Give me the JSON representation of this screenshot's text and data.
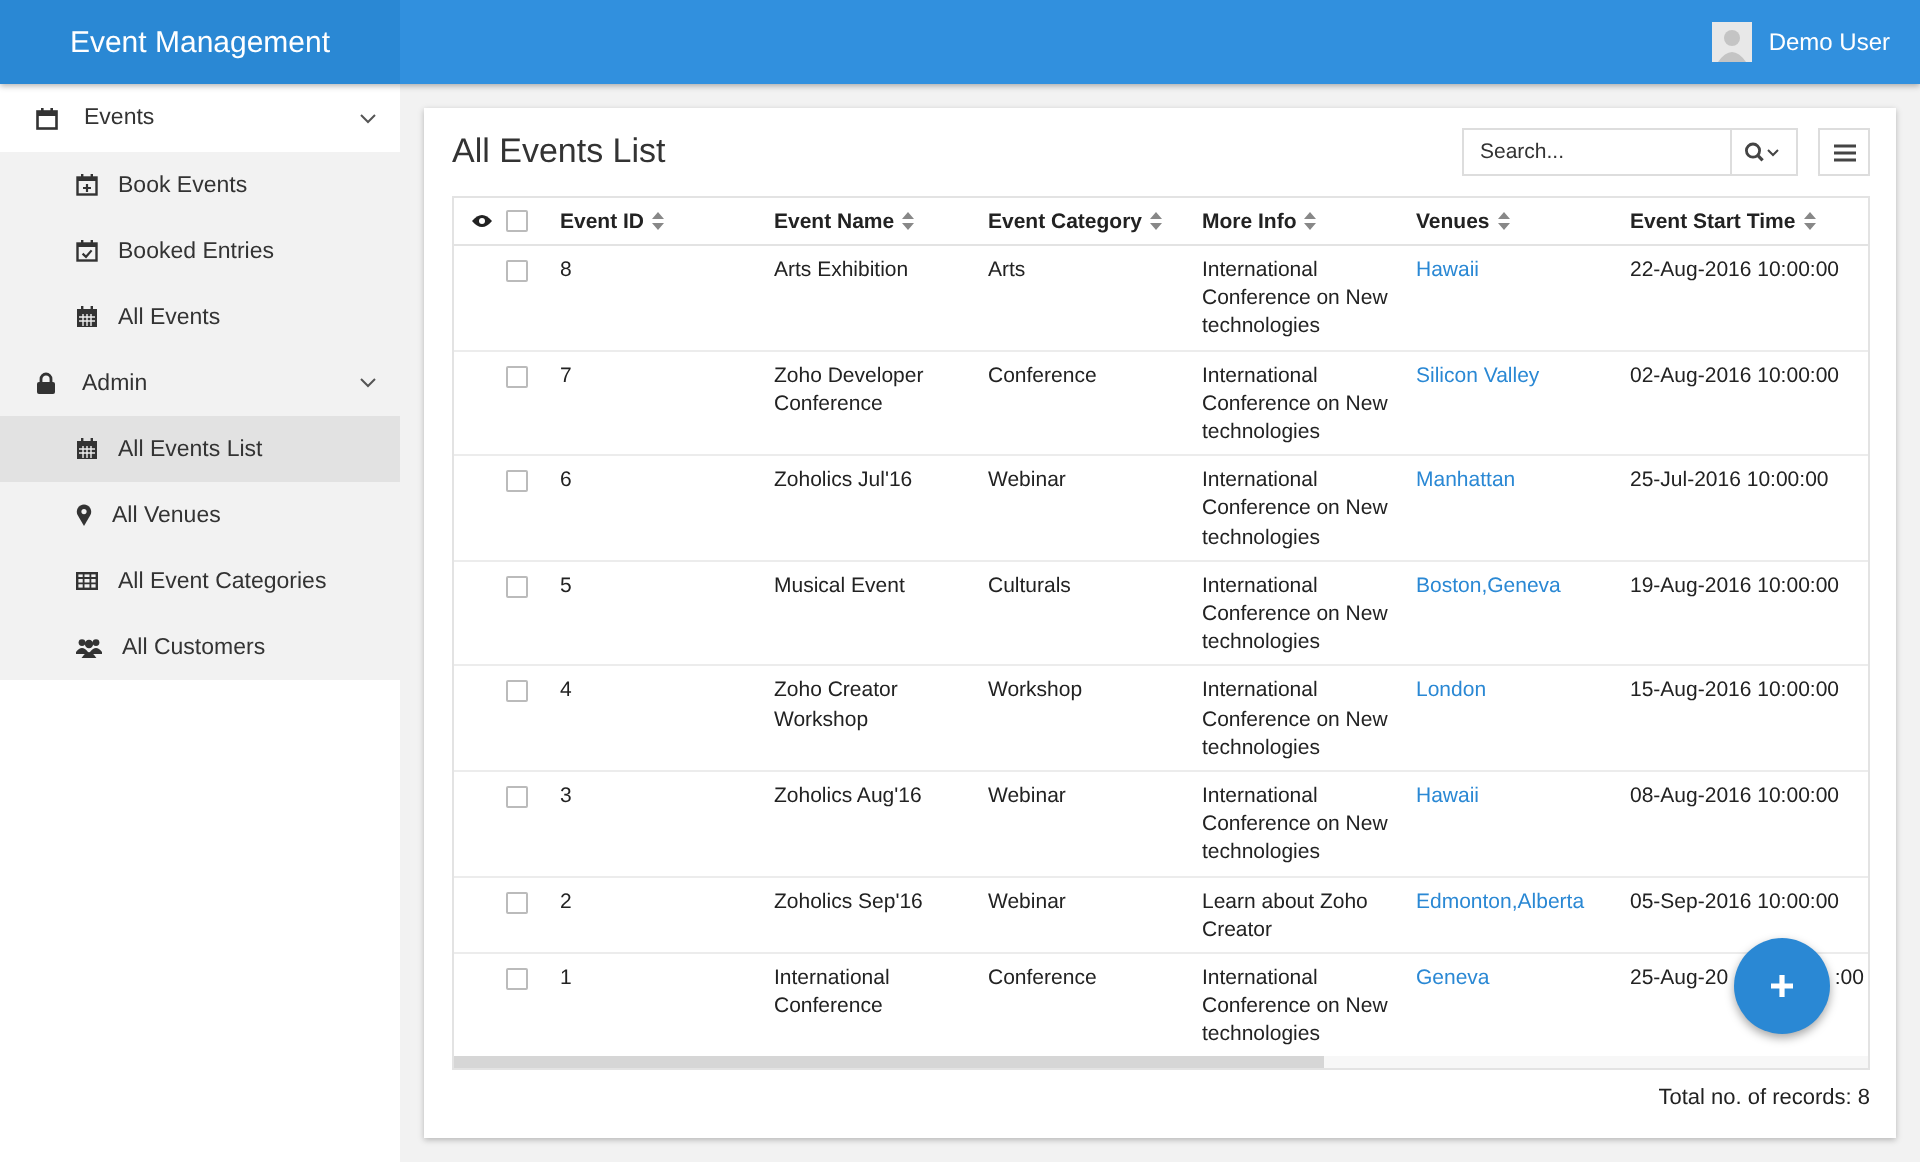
{
  "app_title": "Event Management",
  "user": {
    "name": "Demo User"
  },
  "sidebar": {
    "sections": [
      {
        "label": "Events",
        "expanded": true,
        "children": [
          {
            "label": "Book Events",
            "selected": false
          },
          {
            "label": "Booked Entries",
            "selected": false
          },
          {
            "label": "All Events",
            "selected": false
          }
        ]
      },
      {
        "label": "Admin",
        "expanded": true,
        "children": [
          {
            "label": "All Events List",
            "selected": true
          },
          {
            "label": "All Venues",
            "selected": false
          },
          {
            "label": "All Event Categories",
            "selected": false
          },
          {
            "label": "All Customers",
            "selected": false
          }
        ]
      }
    ]
  },
  "page_title": "All Events List",
  "search": {
    "placeholder": "Search..."
  },
  "table": {
    "select_all_checked": false,
    "columns": [
      "Event ID",
      "Event Name",
      "Event Category",
      "More Info",
      "Venues",
      "Event Start Time"
    ],
    "rows": [
      {
        "checked": false,
        "cells": [
          "8",
          "Arts Exhibition",
          "Arts",
          "International Conference on New technologies",
          "Hawaii",
          "22-Aug-2016 10:00:00"
        ]
      },
      {
        "checked": false,
        "cells": [
          "7",
          "Zoho Developer Conference",
          "Conference",
          "International Conference on New technologies",
          "Silicon Valley",
          "02-Aug-2016 10:00:00"
        ]
      },
      {
        "checked": false,
        "cells": [
          "6",
          "Zoholics Jul'16",
          "Webinar",
          "International Conference on New technologies",
          "Manhattan",
          "25-Jul-2016 10:00:00"
        ]
      },
      {
        "checked": false,
        "cells": [
          "5",
          "Musical Event",
          "Culturals",
          "International Conference on New technologies",
          "Boston,Geneva",
          "19-Aug-2016 10:00:00"
        ]
      },
      {
        "checked": false,
        "cells": [
          "4",
          "Zoho Creator Workshop",
          "Workshop",
          "International Conference on New technologies",
          "London",
          "15-Aug-2016 10:00:00"
        ]
      },
      {
        "checked": false,
        "cells": [
          "3",
          "Zoholics Aug'16",
          "Webinar",
          "International Conference on New technologies",
          "Hawaii",
          "08-Aug-2016 10:00:00"
        ]
      },
      {
        "checked": false,
        "cells": [
          "2",
          "Zoholics Sep'16",
          "Webinar",
          "Learn about Zoho Creator",
          "Edmonton,Alberta",
          "05-Sep-2016 10:00:00"
        ]
      },
      {
        "checked": false,
        "cells": [
          "1",
          "International Conference",
          "Conference",
          "International Conference on New technologies",
          "Geneva",
          "25-Aug-20"
        ],
        "time_tail": ":00"
      }
    ]
  },
  "footer": {
    "total": "Total no. of records: 8"
  }
}
